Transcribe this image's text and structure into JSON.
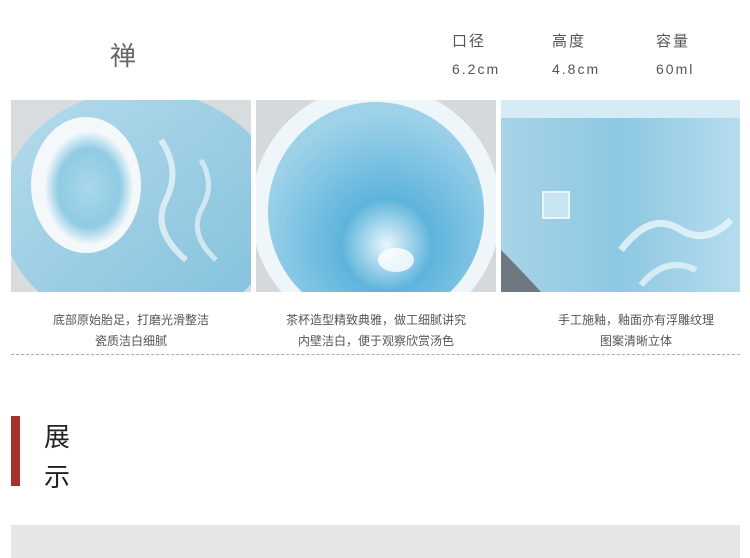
{
  "product": {
    "name": "禅"
  },
  "specs": [
    {
      "label": "口径",
      "value": "6.2cm"
    },
    {
      "label": "高度",
      "value": "4.8cm"
    },
    {
      "label": "容量",
      "value": "60ml"
    }
  ],
  "captions": [
    {
      "line1": "底部原始胎足，打磨光滑整洁",
      "line2": "瓷质洁白细腻"
    },
    {
      "line1": "茶杯造型精致典雅，做工细腻讲究",
      "line2": "内壁洁白，便于观察欣赏汤色"
    },
    {
      "line1": "手工施釉，釉面亦有浮雕纹理",
      "line2": "图案清晰立体"
    }
  ],
  "section": {
    "title_char1": "展",
    "title_char2": "示"
  },
  "colors": {
    "accent_red": "#a7312f",
    "glaze_blue": "#8cc7e0",
    "panel_grey": "#e6e6e6"
  }
}
